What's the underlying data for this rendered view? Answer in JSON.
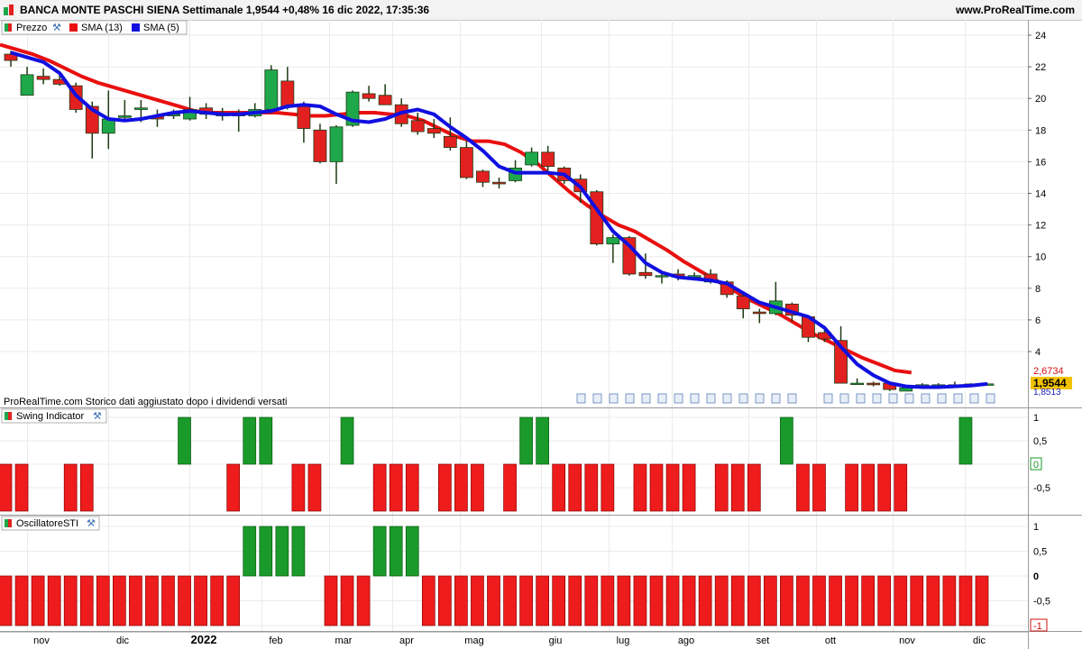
{
  "header": {
    "title": "BANCA MONTE PASCHI SIENA Settimanale 1,9544 +0,48% 16 dic 2022, 17:35:36",
    "site": "www.ProRealTime.com"
  },
  "colors": {
    "up": "#1ea84a",
    "down": "#e32020",
    "sma13": "#e81010",
    "sma5": "#1010e0",
    "bar_green": "#1a9a2a",
    "bar_red": "#ee1c1c"
  },
  "price_panel": {
    "legend": [
      {
        "label": "Prezzo",
        "icon": "wrench-icon"
      },
      {
        "label": "SMA (13)",
        "color": "#e81010"
      },
      {
        "label": "SMA (5)",
        "color": "#1010e0"
      }
    ],
    "note": "ProRealTime.com Storico dati aggiustato dopo i dividendi versati",
    "price_badges": {
      "sma13": "2,6734",
      "last": "1,9544",
      "low": "1,8513"
    }
  },
  "swing_panel": {
    "label": "Swing Indicator"
  },
  "osc_panel": {
    "label": "OscillatoreSTI"
  },
  "x_axis_labels": [
    "nov",
    "dic",
    "2022",
    "feb",
    "mar",
    "apr",
    "mag",
    "giu",
    "lug",
    "ago",
    "set",
    "ott",
    "nov",
    "dic"
  ],
  "chart_data": [
    {
      "type": "candlestick",
      "title": "BANCA MONTE PASCHI SIENA Settimanale",
      "y_ticks": [
        4,
        6,
        8,
        10,
        12,
        14,
        16,
        18,
        20,
        22,
        24
      ],
      "ylim": [
        1.6,
        24.8
      ],
      "grid": true,
      "candles": [
        {
          "o": 22.8,
          "c": 22.4,
          "h": 23.0,
          "l": 22.0
        },
        {
          "o": 20.2,
          "c": 21.5,
          "h": 22.0,
          "l": 20.2
        },
        {
          "o": 21.4,
          "c": 21.2,
          "h": 21.9,
          "l": 20.9
        },
        {
          "o": 21.2,
          "c": 20.9,
          "h": 21.7,
          "l": 20.8
        },
        {
          "o": 20.8,
          "c": 19.3,
          "h": 21.0,
          "l": 19.1
        },
        {
          "o": 19.5,
          "c": 17.8,
          "h": 19.8,
          "l": 16.2
        },
        {
          "o": 17.8,
          "c": 18.7,
          "h": 20.5,
          "l": 16.8
        },
        {
          "o": 18.8,
          "c": 18.9,
          "h": 19.9,
          "l": 18.6
        },
        {
          "o": 19.3,
          "c": 19.4,
          "h": 19.9,
          "l": 18.5
        },
        {
          "o": 18.9,
          "c": 18.7,
          "h": 19.3,
          "l": 18.2
        },
        {
          "o": 18.9,
          "c": 19.0,
          "h": 19.3,
          "l": 18.7
        },
        {
          "o": 18.7,
          "c": 19.3,
          "h": 20.1,
          "l": 18.6
        },
        {
          "o": 19.4,
          "c": 19.0,
          "h": 19.7,
          "l": 18.7
        },
        {
          "o": 19.0,
          "c": 18.9,
          "h": 19.4,
          "l": 18.6
        },
        {
          "o": 19.0,
          "c": 18.9,
          "h": 19.3,
          "l": 17.9
        },
        {
          "o": 18.9,
          "c": 19.3,
          "h": 19.7,
          "l": 18.8
        },
        {
          "o": 19.3,
          "c": 21.8,
          "h": 22.1,
          "l": 19.2
        },
        {
          "o": 21.1,
          "c": 19.5,
          "h": 22.0,
          "l": 19.3
        },
        {
          "o": 19.5,
          "c": 18.1,
          "h": 19.8,
          "l": 17.2
        },
        {
          "o": 18.0,
          "c": 16.0,
          "h": 18.4,
          "l": 15.9
        },
        {
          "o": 16.0,
          "c": 18.2,
          "h": 18.3,
          "l": 14.6
        },
        {
          "o": 18.3,
          "c": 20.4,
          "h": 20.5,
          "l": 18.2
        },
        {
          "o": 20.3,
          "c": 20.0,
          "h": 20.8,
          "l": 19.8
        },
        {
          "o": 20.2,
          "c": 19.6,
          "h": 20.9,
          "l": 19.6
        },
        {
          "o": 19.6,
          "c": 18.4,
          "h": 20.0,
          "l": 18.2
        },
        {
          "o": 18.6,
          "c": 17.9,
          "h": 19.1,
          "l": 17.7
        },
        {
          "o": 18.1,
          "c": 17.8,
          "h": 18.7,
          "l": 17.5
        },
        {
          "o": 17.6,
          "c": 16.9,
          "h": 18.8,
          "l": 16.7
        },
        {
          "o": 16.9,
          "c": 15.0,
          "h": 17.3,
          "l": 14.9
        },
        {
          "o": 15.4,
          "c": 14.7,
          "h": 15.5,
          "l": 14.4
        },
        {
          "o": 14.7,
          "c": 14.6,
          "h": 15.0,
          "l": 14.3
        },
        {
          "o": 14.8,
          "c": 15.6,
          "h": 16.1,
          "l": 14.7
        },
        {
          "o": 15.8,
          "c": 16.6,
          "h": 16.9,
          "l": 15.7
        },
        {
          "o": 16.6,
          "c": 15.7,
          "h": 17.0,
          "l": 15.2
        },
        {
          "o": 15.6,
          "c": 14.8,
          "h": 15.7,
          "l": 14.6
        },
        {
          "o": 14.9,
          "c": 14.1,
          "h": 15.2,
          "l": 13.4
        },
        {
          "o": 14.1,
          "c": 10.8,
          "h": 14.2,
          "l": 10.7
        },
        {
          "o": 10.8,
          "c": 11.2,
          "h": 11.4,
          "l": 9.6
        },
        {
          "o": 11.2,
          "c": 8.9,
          "h": 11.3,
          "l": 8.8
        },
        {
          "o": 9.0,
          "c": 8.8,
          "h": 10.2,
          "l": 8.6
        },
        {
          "o": 8.8,
          "c": 8.8,
          "h": 9.1,
          "l": 8.3
        },
        {
          "o": 8.9,
          "c": 8.7,
          "h": 9.2,
          "l": 8.5
        },
        {
          "o": 8.7,
          "c": 8.8,
          "h": 9.0,
          "l": 8.5
        },
        {
          "o": 8.9,
          "c": 8.4,
          "h": 9.2,
          "l": 8.3
        },
        {
          "o": 8.4,
          "c": 7.6,
          "h": 8.5,
          "l": 7.4
        },
        {
          "o": 7.5,
          "c": 6.7,
          "h": 7.6,
          "l": 6.1
        },
        {
          "o": 6.5,
          "c": 6.4,
          "h": 6.7,
          "l": 5.8
        },
        {
          "o": 6.4,
          "c": 7.2,
          "h": 8.4,
          "l": 6.3
        },
        {
          "o": 7.0,
          "c": 6.3,
          "h": 7.1,
          "l": 5.9
        },
        {
          "o": 6.2,
          "c": 4.9,
          "h": 6.3,
          "l": 4.6
        },
        {
          "o": 5.2,
          "c": 4.8,
          "h": 5.5,
          "l": 4.6
        },
        {
          "o": 4.7,
          "c": 2.0,
          "h": 5.6,
          "l": 2.0
        },
        {
          "o": 2.0,
          "c": 2.0,
          "h": 2.3,
          "l": 1.9
        },
        {
          "o": 2.0,
          "c": 1.9,
          "h": 2.1,
          "l": 1.8
        },
        {
          "o": 2.0,
          "c": 1.6,
          "h": 2.1,
          "l": 1.5
        },
        {
          "o": 1.5,
          "c": 1.7,
          "h": 1.8,
          "l": 1.5
        },
        {
          "o": 1.9,
          "c": 1.9,
          "h": 2.0,
          "l": 1.7
        },
        {
          "o": 1.9,
          "c": 1.9,
          "h": 2.0,
          "l": 1.8
        },
        {
          "o": 1.9,
          "c": 1.9,
          "h": 2.1,
          "l": 1.8
        },
        {
          "o": 1.9,
          "c": 1.95,
          "h": 2.0,
          "l": 1.85
        },
        {
          "o": 1.9,
          "c": 1.9544,
          "h": 2.0,
          "l": 1.85
        }
      ],
      "sma13": [
        23.4,
        23.1,
        22.8,
        22.4,
        21.9,
        21.4,
        21.0,
        20.7,
        20.4,
        20.1,
        19.8,
        19.5,
        19.2,
        19.1,
        19.1,
        19.1,
        19.1,
        19.1,
        19.0,
        18.9,
        18.9,
        19.0,
        19.1,
        19.1,
        19.0,
        18.9,
        18.6,
        18.1,
        17.6,
        17.3,
        17.3,
        17.1,
        16.6,
        15.9,
        15.0,
        14.1,
        13.3,
        12.6,
        12.0,
        11.6,
        11.0,
        10.4,
        9.7,
        9.1,
        8.5,
        7.9,
        7.3,
        6.8,
        6.3,
        5.7,
        5.1,
        4.6,
        4.1,
        3.6,
        3.2,
        2.8,
        2.67
      ],
      "sma5": [
        22.9,
        22.6,
        22.3,
        21.6,
        20.2,
        19.3,
        18.7,
        18.6,
        18.7,
        18.9,
        19.1,
        19.2,
        19.1,
        19.0,
        19.0,
        19.1,
        19.2,
        19.5,
        19.6,
        19.5,
        19.0,
        18.6,
        18.5,
        18.7,
        19.1,
        19.3,
        19.0,
        18.2,
        17.5,
        16.7,
        15.7,
        15.3,
        15.3,
        15.3,
        15.2,
        14.4,
        13.0,
        11.6,
        10.7,
        9.6,
        9.0,
        8.7,
        8.6,
        8.5,
        8.3,
        7.7,
        7.1,
        6.8,
        6.5,
        6.2,
        5.5,
        4.3,
        3.2,
        2.5,
        2.0,
        1.8,
        1.75,
        1.75,
        1.8,
        1.85,
        1.9544
      ]
    },
    {
      "type": "bar",
      "title": "Swing Indicator",
      "y_ticks": [
        "1",
        "0,5",
        "0",
        "-0,5"
      ],
      "values": [
        -1,
        -1,
        null,
        null,
        -1,
        -1,
        null,
        null,
        null,
        null,
        null,
        1,
        null,
        null,
        -1,
        1,
        1,
        null,
        -1,
        -1,
        null,
        1,
        null,
        -1,
        -1,
        -1,
        null,
        -1,
        -1,
        -1,
        null,
        -1,
        1,
        1,
        -1,
        -1,
        -1,
        -1,
        null,
        -1,
        -1,
        -1,
        -1,
        null,
        -1,
        -1,
        -1,
        null,
        1,
        -1,
        -1,
        null,
        -1,
        -1,
        -1,
        -1,
        null,
        null,
        null,
        1,
        null
      ]
    },
    {
      "type": "bar",
      "title": "OscillatoreSTI",
      "y_ticks": [
        "1",
        "0,5",
        "0",
        "-0,5",
        "-1"
      ],
      "values": [
        -1,
        -1,
        -1,
        -1,
        -1,
        -1,
        -1,
        -1,
        -1,
        -1,
        -1,
        -1,
        -1,
        -1,
        -1,
        1,
        1,
        1,
        1,
        null,
        -1,
        -1,
        -1,
        1,
        1,
        1,
        -1,
        -1,
        -1,
        -1,
        -1,
        -1,
        -1,
        -1,
        -1,
        -1,
        -1,
        -1,
        -1,
        -1,
        -1,
        -1,
        -1,
        -1,
        -1,
        -1,
        -1,
        -1,
        -1,
        -1,
        -1,
        -1,
        -1,
        -1,
        -1,
        -1,
        -1,
        -1,
        -1,
        -1,
        -1
      ]
    }
  ]
}
